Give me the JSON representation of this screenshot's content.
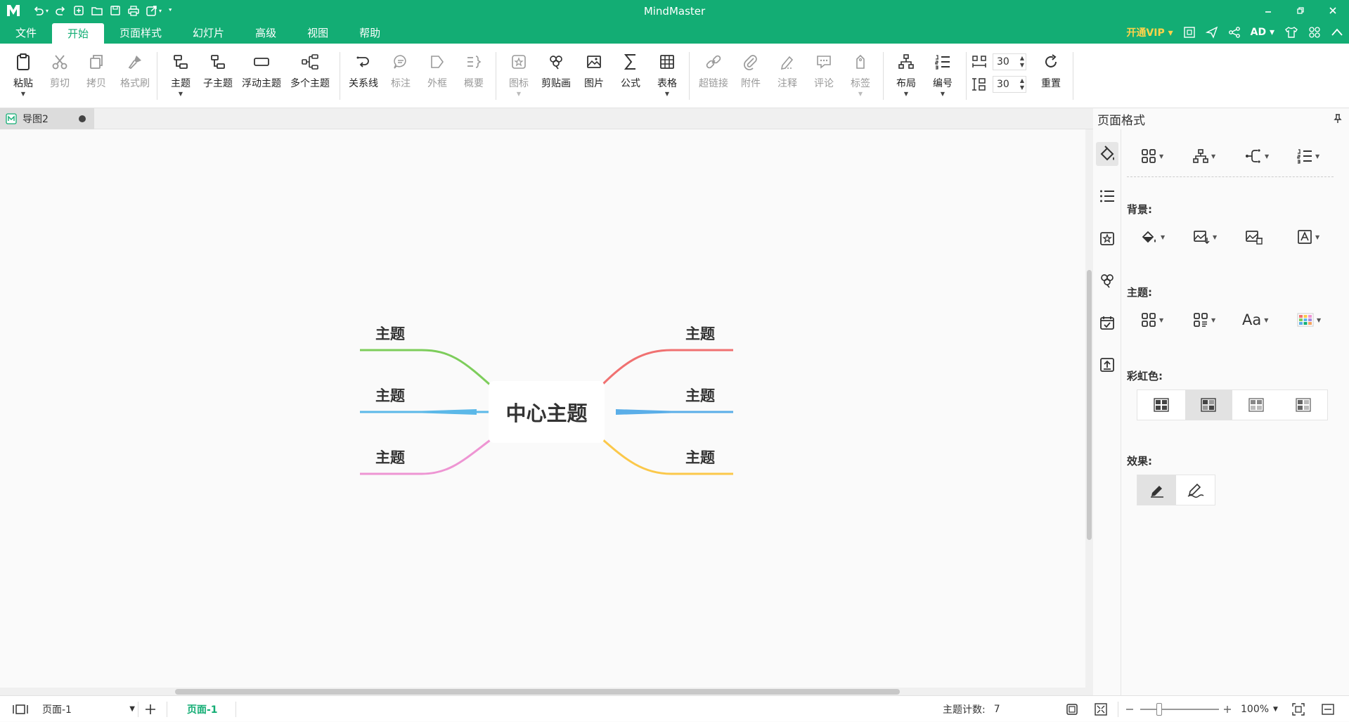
{
  "app": {
    "title": "MindMaster"
  },
  "colors": {
    "brand": "#13ad74",
    "vip": "#ffd34a",
    "branch_green": "#7dcd5b",
    "branch_blue": "#5bb8e8",
    "branch_pink": "#ee95d3",
    "branch_red": "#f07171",
    "branch_sky": "#5aaee8",
    "branch_yellow": "#fbc84a"
  },
  "menu": {
    "items": [
      "文件",
      "开始",
      "页面样式",
      "幻灯片",
      "高级",
      "视图",
      "帮助"
    ],
    "active": "开始",
    "vip": "开通VIP",
    "user": "AD"
  },
  "ribbon": {
    "paste": "粘贴",
    "cut": "剪切",
    "copy": "拷贝",
    "format_painter": "格式刷",
    "topic": "主题",
    "subtopic": "子主题",
    "floating_topic": "浮动主题",
    "multi_topic": "多个主题",
    "relationship": "关系线",
    "callout": "标注",
    "boundary": "外框",
    "summary": "概要",
    "icon": "图标",
    "clipart": "剪贴画",
    "picture": "图片",
    "formula": "公式",
    "table": "表格",
    "hyperlink": "超链接",
    "attachment": "附件",
    "note": "注释",
    "comment": "评论",
    "tag": "标签",
    "layout": "布局",
    "numbering": "编号",
    "h_spacing": "30",
    "v_spacing": "30",
    "reset": "重置"
  },
  "doc": {
    "tab": "导图2"
  },
  "panel": {
    "title": "页面格式",
    "background_label": "背景:",
    "theme_label": "主题:",
    "rainbow_label": "彩虹色:",
    "effects_label": "效果:",
    "font_sample": "Aa"
  },
  "mindmap": {
    "center": "中心主题",
    "left": [
      "主题",
      "主题",
      "主题"
    ],
    "right": [
      "主题",
      "主题",
      "主题"
    ]
  },
  "status": {
    "page_select": "页面-1",
    "page_tab": "页面-1",
    "topic_count_label": "主题计数:",
    "topic_count": "7",
    "zoom": "100%"
  }
}
